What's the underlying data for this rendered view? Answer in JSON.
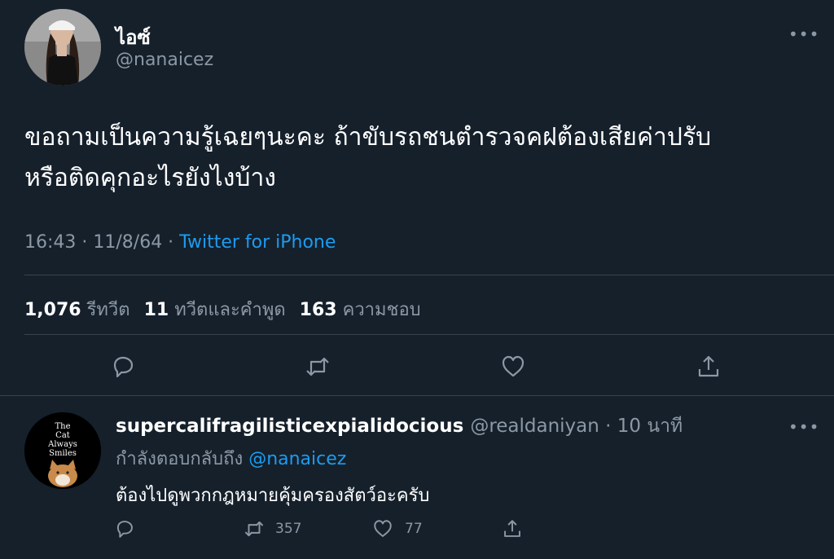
{
  "main_tweet": {
    "display_name": "ไอซ์",
    "handle": "@nanaicez",
    "more_icon": "more-horizontal-icon",
    "text_line1": "ขอถามเป็นความรู้เฉยๆนะคะ ถ้าขับรถชนตำรวจคฝต้องเสียค่าปรับ",
    "text_line2": "หรือติดคุกอะไรยังไงบ้าง",
    "time_date": "16:43 · 11/8/64 · ",
    "source": "Twitter for iPhone",
    "stats": {
      "retweets_count": "1,076",
      "retweets_label": "รีทวีต",
      "quotes_count": "11",
      "quotes_label": "ทวีตและคำพูด",
      "likes_count": "163",
      "likes_label": "ความชอบ"
    },
    "actions": [
      "reply-icon",
      "retweet-icon",
      "like-icon",
      "share-icon"
    ]
  },
  "reply_tweet": {
    "display_name": "supercalifragilisticexpialidocious",
    "handle_time": "@realdaniyan · 10 นาที",
    "replying_to_label": "กำลังตอบกลับถึง ",
    "replying_to_handle": "@nanaicez",
    "text": "ต้องไปดูพวกกฎหมายคุ้มครองสัตว์อะครับ",
    "avatar_text": [
      "The",
      "Cat",
      "Always",
      "Smiles"
    ],
    "retweet_count": "357",
    "like_count": "77"
  },
  "colors": {
    "background": "#15202b",
    "text": "#ffffff",
    "muted": "#8b98a5",
    "link": "#1d9bf0",
    "divider": "#38444d"
  }
}
